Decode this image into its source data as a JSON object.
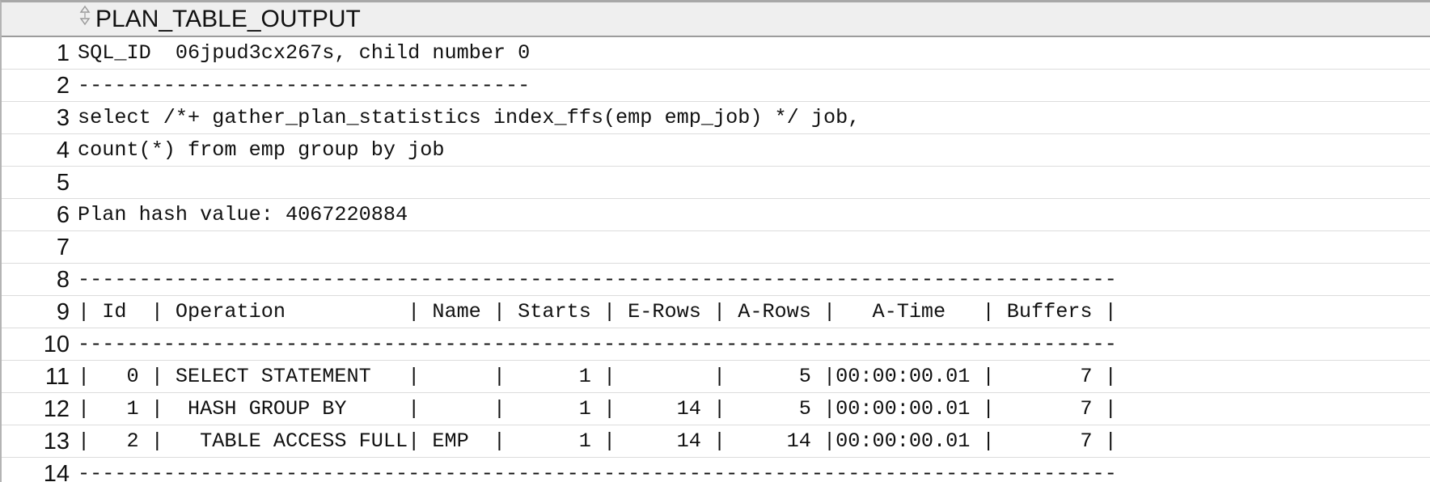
{
  "grid": {
    "column_header": "PLAN_TABLE_OUTPUT",
    "sort_icon": "sort-handle-icon",
    "rows": [
      {
        "num": "1",
        "text": "SQL_ID  06jpud3cx267s, child number 0"
      },
      {
        "num": "2",
        "text": "-------------------------------------"
      },
      {
        "num": "3",
        "text": "select /*+ gather_plan_statistics index_ffs(emp emp_job) */ job,"
      },
      {
        "num": "4",
        "text": "count(*) from emp group by job"
      },
      {
        "num": "5",
        "text": ""
      },
      {
        "num": "6",
        "text": "Plan hash value: 4067220884"
      },
      {
        "num": "7",
        "text": ""
      },
      {
        "num": "8",
        "text": "-------------------------------------------------------------------------------------"
      },
      {
        "num": "9",
        "text": "| Id  | Operation          | Name | Starts | E-Rows | A-Rows |   A-Time   | Buffers |"
      },
      {
        "num": "10",
        "text": "-------------------------------------------------------------------------------------"
      },
      {
        "num": "11",
        "text": "|   0 | SELECT STATEMENT   |      |      1 |        |      5 |00:00:00.01 |       7 |"
      },
      {
        "num": "12",
        "text": "|   1 |  HASH GROUP BY     |      |      1 |     14 |      5 |00:00:00.01 |       7 |"
      },
      {
        "num": "13",
        "text": "|   2 |   TABLE ACCESS FULL| EMP  |      1 |     14 |     14 |00:00:00.01 |       7 |"
      },
      {
        "num": "14",
        "text": "-------------------------------------------------------------------------------------"
      }
    ]
  }
}
